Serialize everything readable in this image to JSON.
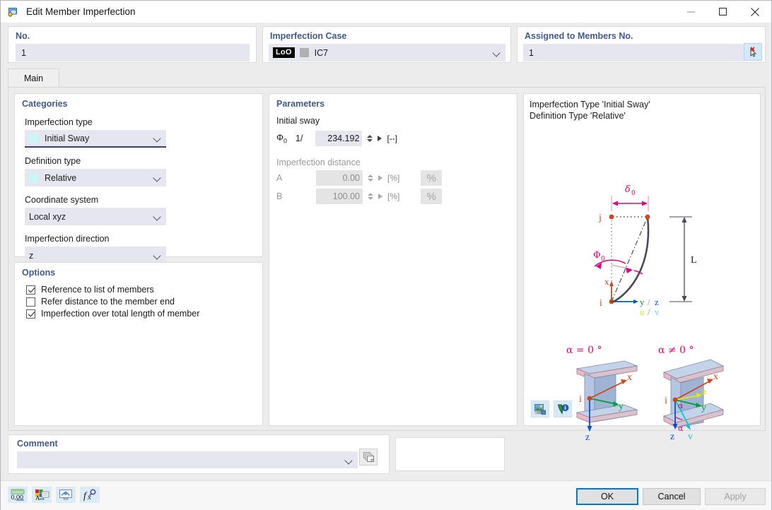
{
  "window": {
    "title": "Edit Member Imperfection",
    "icon": "member-imperfection-icon",
    "minimize": "—",
    "maximize": "☐",
    "close": "✕"
  },
  "header": {
    "no": {
      "label": "No.",
      "value": "1"
    },
    "imperfection_case": {
      "label": "Imperfection Case",
      "badge": "LoO",
      "swatch_color": "#b0b0b0",
      "value": "IC7"
    },
    "assigned_members": {
      "label": "Assigned to Members No.",
      "value": "1",
      "pick_button": "select-members-icon"
    }
  },
  "tabs": [
    {
      "label": "Main",
      "active": true
    }
  ],
  "categories": {
    "title": "Categories",
    "fields": [
      {
        "label": "Imperfection type",
        "value": "Initial Sway",
        "swatch": "#c9f7f7",
        "focused": true
      },
      {
        "label": "Definition type",
        "value": "Relative",
        "swatch": "#c9f7f7",
        "focused": false
      },
      {
        "label": "Coordinate system",
        "value": "Local xyz",
        "swatch": null,
        "focused": false
      },
      {
        "label": "Imperfection direction",
        "value": "z",
        "swatch": null,
        "focused": false
      }
    ]
  },
  "options": {
    "title": "Options",
    "items": [
      {
        "label": "Reference to list of members",
        "checked": true
      },
      {
        "label": "Refer distance to the member end",
        "checked": false
      },
      {
        "label": "Imperfection over total length of member",
        "checked": true
      }
    ]
  },
  "parameters": {
    "title": "Parameters",
    "initial_sway": {
      "group_label": "Initial sway",
      "symbol": "Φ",
      "subscript": "0",
      "prefix": "1/",
      "value": "234.192",
      "unit": "[--]"
    },
    "imperfection_distance": {
      "group_label": "Imperfection distance",
      "disabled": true,
      "rows": [
        {
          "label": "A",
          "value": "0.00",
          "unit": "[%]",
          "button": "%"
        },
        {
          "label": "B",
          "value": "100.00",
          "unit": "[%]",
          "button": "%"
        }
      ]
    }
  },
  "preview": {
    "caption_line1": "Imperfection Type 'Initial Sway'",
    "caption_line2": "Definition Type 'Relative'",
    "diagram": {
      "delta_label": "δ",
      "delta_sub": "0",
      "phi_label": "Φ",
      "phi_sub": "0",
      "length_label": "L",
      "node_start": "i",
      "node_end": "j",
      "axis_x": "x",
      "axis_y": "y",
      "axis_z": "z",
      "axis_sep": "/",
      "axis_u": "u",
      "axis_v": "v",
      "colors": {
        "magenta": "#e5007e",
        "orange": "#d2441c",
        "green": "#00a03c",
        "blue": "#0b4fd1",
        "yellow": "#e8e800",
        "cyan": "#00c8e0",
        "curve": "#4a4a58"
      }
    },
    "beams": [
      {
        "alpha_label": "α = 0 °",
        "axes": [
          "x",
          "y",
          "z"
        ]
      },
      {
        "alpha_label": "α ≠ 0 °",
        "axes": [
          "x",
          "u",
          "y",
          "z",
          "v",
          "α"
        ]
      }
    ],
    "buttons": [
      {
        "name": "image-settings-icon"
      },
      {
        "name": "info-icon"
      }
    ]
  },
  "comment": {
    "label": "Comment",
    "value": "",
    "placeholder": "",
    "button": "comment-library-icon"
  },
  "toolbar": [
    {
      "name": "number-format-icon",
      "text": "0.00"
    },
    {
      "name": "display-properties-icon",
      "text": "A"
    },
    {
      "name": "view-settings-icon",
      "text": ""
    },
    {
      "name": "formula-icon",
      "text": "fx"
    }
  ],
  "dialog_buttons": {
    "ok": "OK",
    "cancel": "Cancel",
    "apply": "Apply",
    "apply_disabled": true
  }
}
